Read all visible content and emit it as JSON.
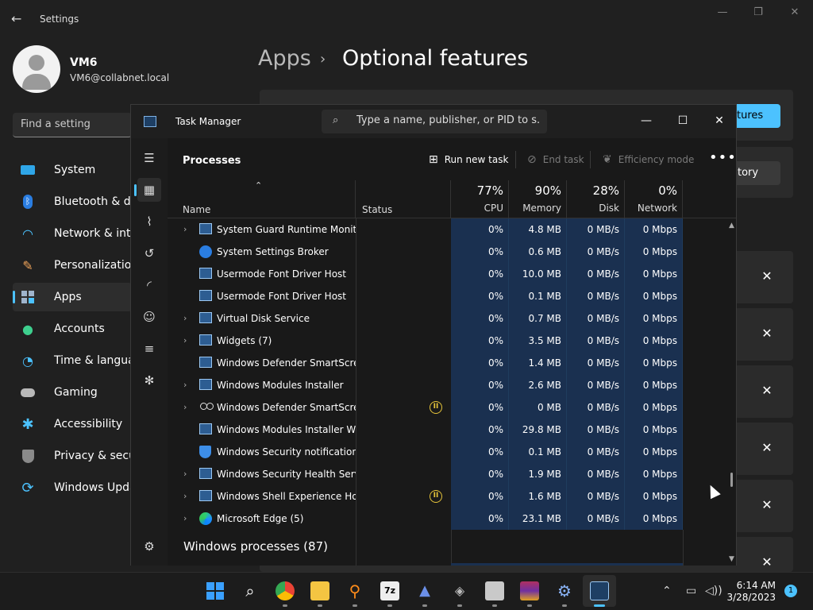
{
  "settings": {
    "title": "Settings",
    "user": {
      "name": "VM6",
      "email": "VM6@collabnet.local"
    },
    "search_placeholder": "Find a setting",
    "nav": [
      {
        "label": "System",
        "icon": "monitor-icon"
      },
      {
        "label": "Bluetooth & devi",
        "icon": "bluetooth-icon"
      },
      {
        "label": "Network & intern",
        "icon": "wifi-icon"
      },
      {
        "label": "Personalization",
        "icon": "brush-icon"
      },
      {
        "label": "Apps",
        "icon": "apps-icon"
      },
      {
        "label": "Accounts",
        "icon": "person-icon"
      },
      {
        "label": "Time & language",
        "icon": "clock-globe-icon"
      },
      {
        "label": "Gaming",
        "icon": "gamepad-icon"
      },
      {
        "label": "Accessibility",
        "icon": "accessibility-icon"
      },
      {
        "label": "Privacy & security",
        "icon": "shield-icon"
      },
      {
        "label": "Windows Update",
        "icon": "update-icon"
      }
    ],
    "breadcrumb": {
      "parent": "Apps",
      "separator": "›",
      "current": "Optional features"
    },
    "view_features_label": "tures",
    "history_label": "tory"
  },
  "taskmanager": {
    "title": "Task Manager",
    "search_placeholder": "Type a name, publisher, or PID to s...",
    "page_title": "Processes",
    "actions": {
      "run_new_task": "Run new task",
      "end_task": "End task",
      "efficiency_mode": "Efficiency mode"
    },
    "columns": {
      "name": "Name",
      "status": "Status",
      "cpu": {
        "pct": "77%",
        "label": "CPU"
      },
      "memory": {
        "pct": "90%",
        "label": "Memory"
      },
      "disk": {
        "pct": "28%",
        "label": "Disk"
      },
      "network": {
        "pct": "0%",
        "label": "Network"
      }
    },
    "processes": [
      {
        "name": "System Guard Runtime Monit...",
        "expandable": true,
        "icon": "window-icon",
        "status": "",
        "cpu": "0%",
        "memory": "4.8 MB",
        "disk": "0 MB/s",
        "network": "0 Mbps"
      },
      {
        "name": "System Settings Broker",
        "expandable": false,
        "icon": "gear-icon",
        "status": "",
        "cpu": "0%",
        "memory": "0.6 MB",
        "disk": "0 MB/s",
        "network": "0 Mbps"
      },
      {
        "name": "Usermode Font Driver Host",
        "expandable": false,
        "icon": "window-icon",
        "status": "",
        "cpu": "0%",
        "memory": "10.0 MB",
        "disk": "0 MB/s",
        "network": "0 Mbps"
      },
      {
        "name": "Usermode Font Driver Host",
        "expandable": false,
        "icon": "window-icon",
        "status": "",
        "cpu": "0%",
        "memory": "0.1 MB",
        "disk": "0 MB/s",
        "network": "0 Mbps"
      },
      {
        "name": "Virtual Disk Service",
        "expandable": true,
        "icon": "window-icon",
        "status": "",
        "cpu": "0%",
        "memory": "0.7 MB",
        "disk": "0 MB/s",
        "network": "0 Mbps"
      },
      {
        "name": "Widgets (7)",
        "expandable": true,
        "icon": "window-icon",
        "status": "",
        "cpu": "0%",
        "memory": "3.5 MB",
        "disk": "0 MB/s",
        "network": "0 Mbps"
      },
      {
        "name": "Windows Defender SmartScreen",
        "expandable": false,
        "icon": "window-icon",
        "status": "",
        "cpu": "0%",
        "memory": "1.4 MB",
        "disk": "0 MB/s",
        "network": "0 Mbps"
      },
      {
        "name": "Windows Modules Installer",
        "expandable": true,
        "icon": "window-icon",
        "status": "",
        "cpu": "0%",
        "memory": "2.6 MB",
        "disk": "0 MB/s",
        "network": "0 Mbps"
      },
      {
        "name": "Windows Defender SmartScreen",
        "expandable": true,
        "icon": "group-icon",
        "status": "paused",
        "cpu": "0%",
        "memory": "0 MB",
        "disk": "0 MB/s",
        "network": "0 Mbps"
      },
      {
        "name": "Windows Modules Installer W...",
        "expandable": false,
        "icon": "window-icon",
        "status": "",
        "cpu": "0%",
        "memory": "29.8 MB",
        "disk": "0 MB/s",
        "network": "0 Mbps"
      },
      {
        "name": "Windows Security notification...",
        "expandable": false,
        "icon": "shield-icon",
        "status": "",
        "cpu": "0%",
        "memory": "0.1 MB",
        "disk": "0 MB/s",
        "network": "0 Mbps"
      },
      {
        "name": "Windows Security Health Servi...",
        "expandable": true,
        "icon": "window-icon",
        "status": "",
        "cpu": "0%",
        "memory": "1.9 MB",
        "disk": "0 MB/s",
        "network": "0 Mbps"
      },
      {
        "name": "Windows Shell Experience Ho...",
        "expandable": true,
        "icon": "window-icon",
        "status": "paused",
        "cpu": "0%",
        "memory": "1.6 MB",
        "disk": "0 MB/s",
        "network": "0 Mbps"
      },
      {
        "name": "Microsoft Edge (5)",
        "expandable": true,
        "icon": "edge-icon",
        "status": "",
        "cpu": "0%",
        "memory": "23.1 MB",
        "disk": "0 MB/s",
        "network": "0 Mbps"
      }
    ],
    "group_header": "Windows processes (87)"
  },
  "taskbar": {
    "time": "6:14 AM",
    "date": "3/28/2023",
    "notification_count": "1"
  },
  "colors": {
    "accent": "#4cc2ff",
    "highlight_column": "#1a3050",
    "paused_status": "#e5c33a"
  }
}
